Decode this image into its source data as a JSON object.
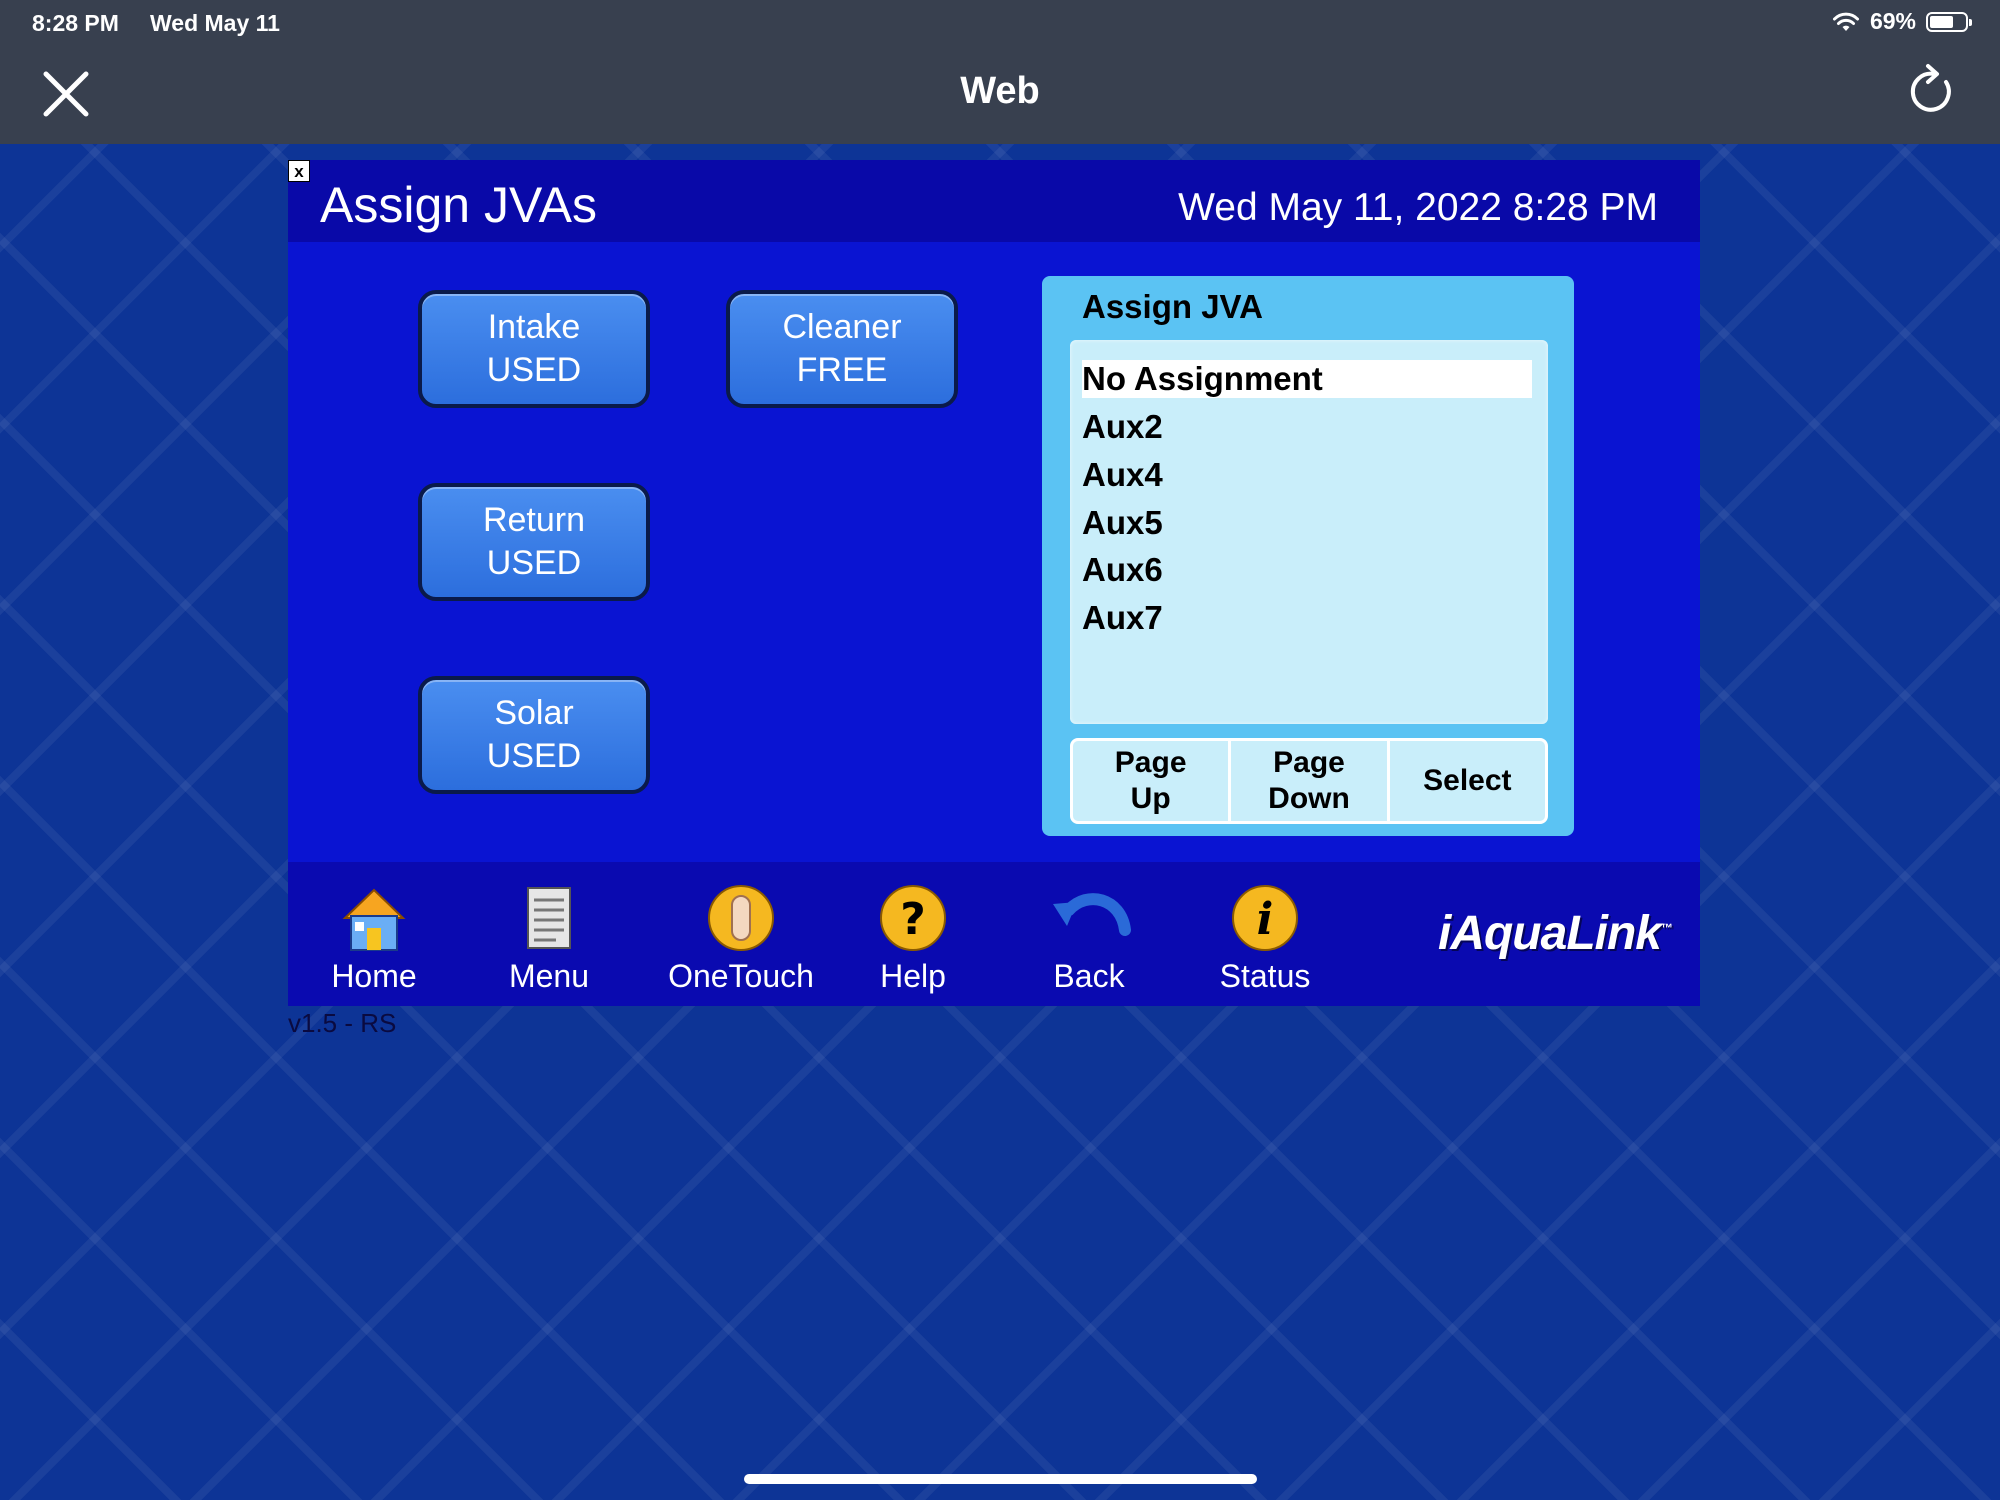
{
  "status_bar": {
    "time": "8:28 PM",
    "date": "Wed May 11",
    "battery_percent": "69%",
    "battery_level": 0.69
  },
  "header": {
    "title": "Web",
    "close_icon": "close-icon",
    "refresh_icon": "refresh-icon"
  },
  "panel": {
    "close_label": "x",
    "title": "Assign JVAs",
    "datetime": "Wed May 11, 2022 8:28 PM",
    "buttons": [
      {
        "name": "Intake",
        "state": "USED"
      },
      {
        "name": "Cleaner",
        "state": "FREE"
      },
      {
        "name": "Return",
        "state": "USED"
      },
      {
        "name": "Solar",
        "state": "USED"
      }
    ],
    "assign": {
      "title": "Assign JVA",
      "items": [
        "No Assignment",
        "Aux2",
        "Aux4",
        "Aux5",
        "Aux6",
        "Aux7"
      ],
      "selected": "No Assignment",
      "controls": {
        "page_up_1": "Page",
        "page_up_2": "Up",
        "page_down_1": "Page",
        "page_down_2": "Down",
        "select": "Select"
      }
    },
    "nav": [
      {
        "label": "Home",
        "icon": "home-icon"
      },
      {
        "label": "Menu",
        "icon": "menu-icon"
      },
      {
        "label": "OneTouch",
        "icon": "onetouch-icon"
      },
      {
        "label": "Help",
        "icon": "help-icon"
      },
      {
        "label": "Back",
        "icon": "back-icon"
      },
      {
        "label": "Status",
        "icon": "status-icon"
      }
    ],
    "logo": "iAquaLink",
    "logo_tm": "™"
  },
  "version": "v1.5 - RS",
  "colors": {
    "panel": "#0a14d2",
    "button": "#3a7ee8",
    "assign_box": "#5bc3f3",
    "list_bg": "#c9eefa",
    "topbar": "#38404f"
  }
}
